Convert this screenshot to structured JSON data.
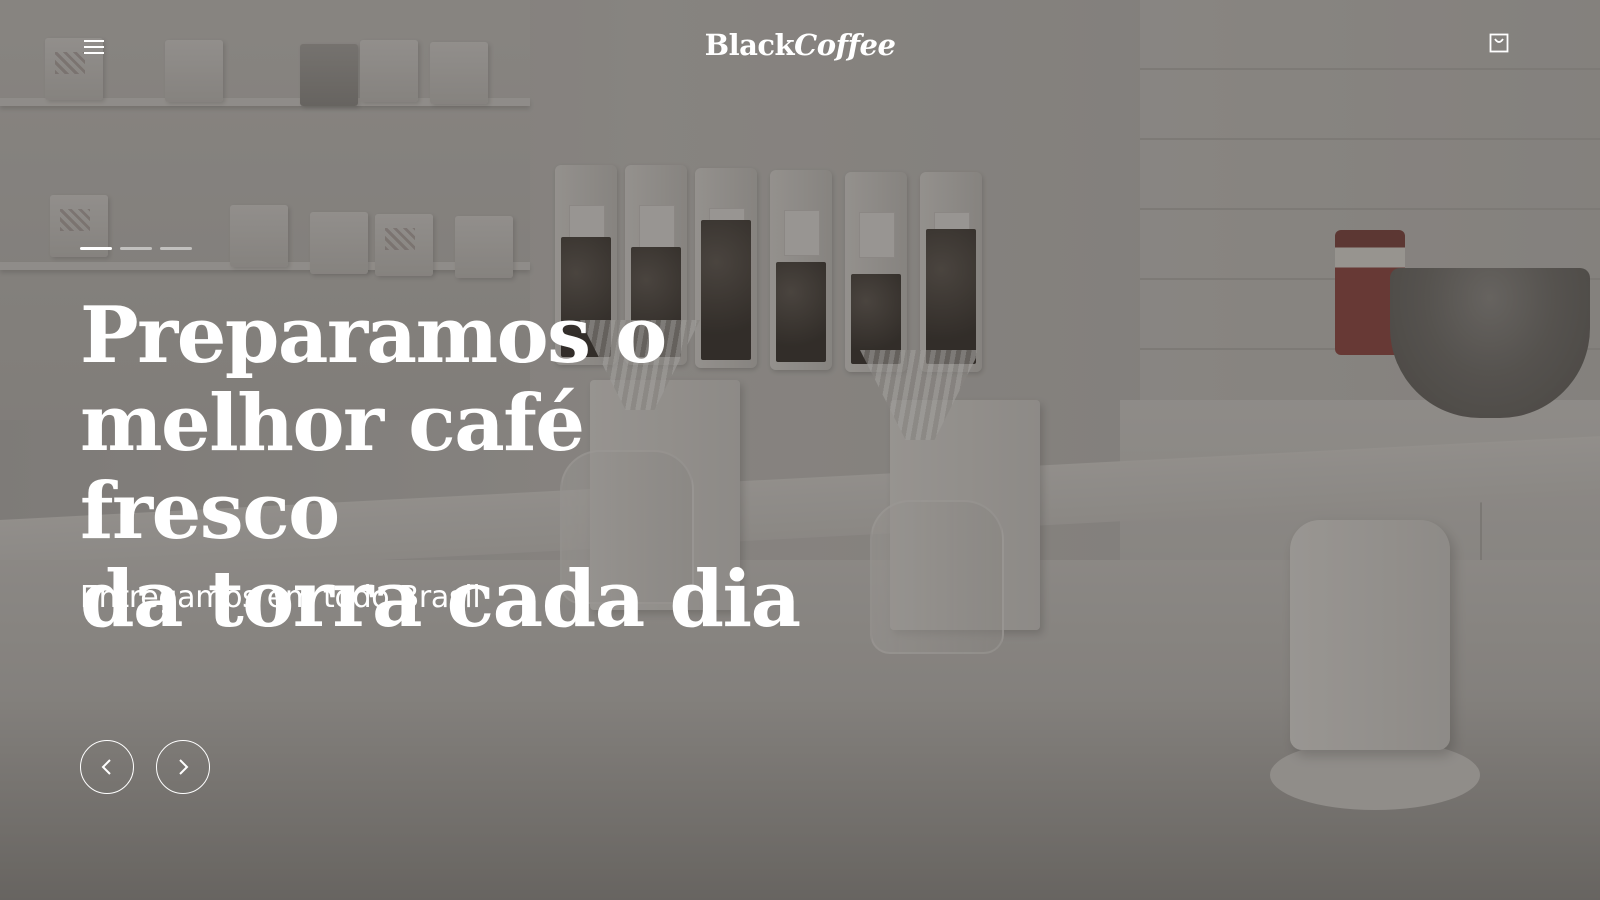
{
  "header": {
    "menu_icon": "hamburger-menu-icon",
    "logo_part1": "Black",
    "logo_part2": "Coffee",
    "cart_icon": "shopping-bag-icon"
  },
  "hero": {
    "headline_line1": "Preparamos o",
    "headline_line2": "melhor café fresco",
    "headline_line3": "da torra cada dia",
    "subline": "Entregamos em todo Brasil",
    "slides_total": 3,
    "active_slide": 1,
    "prev_icon": "chevron-left-icon",
    "next_icon": "chevron-right-icon"
  },
  "colors": {
    "text": "#ffffff",
    "overlay": "#37322e"
  }
}
